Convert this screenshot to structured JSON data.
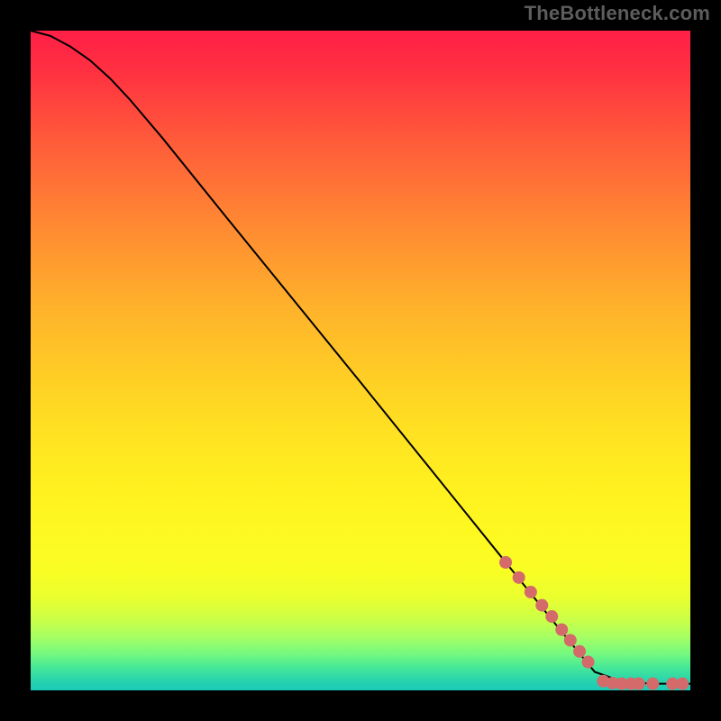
{
  "chart_data": {
    "type": "line",
    "title": "",
    "xlabel": "",
    "ylabel": "",
    "xlim": [
      0,
      1
    ],
    "ylim": [
      0,
      1
    ],
    "grid": false,
    "series": [
      {
        "name": "curve",
        "color": "#000000",
        "x": [
          0.0,
          0.03,
          0.06,
          0.09,
          0.12,
          0.15,
          0.2,
          0.3,
          0.4,
          0.5,
          0.6,
          0.7,
          0.8,
          0.855,
          0.9,
          0.95,
          1.0
        ],
        "y": [
          1.0,
          0.992,
          0.976,
          0.955,
          0.928,
          0.896,
          0.837,
          0.713,
          0.59,
          0.467,
          0.343,
          0.219,
          0.095,
          0.028,
          0.012,
          0.01,
          0.01
        ]
      }
    ],
    "markers": {
      "name": "points",
      "color": "#d46a6a",
      "radius_px": 7,
      "x": [
        0.72,
        0.74,
        0.758,
        0.775,
        0.79,
        0.805,
        0.818,
        0.832,
        0.845,
        0.868,
        0.882,
        0.896,
        0.91,
        0.922,
        0.943,
        0.973,
        0.988
      ],
      "y": [
        0.194,
        0.171,
        0.149,
        0.129,
        0.112,
        0.092,
        0.076,
        0.059,
        0.043,
        0.014,
        0.011,
        0.01,
        0.01,
        0.01,
        0.01,
        0.01,
        0.01
      ]
    }
  },
  "watermark": "TheBottleneck.com",
  "colors": {
    "background": "#000000",
    "curve": "#000000",
    "marker": "#d46a6a",
    "watermark": "#5d5d5d"
  }
}
